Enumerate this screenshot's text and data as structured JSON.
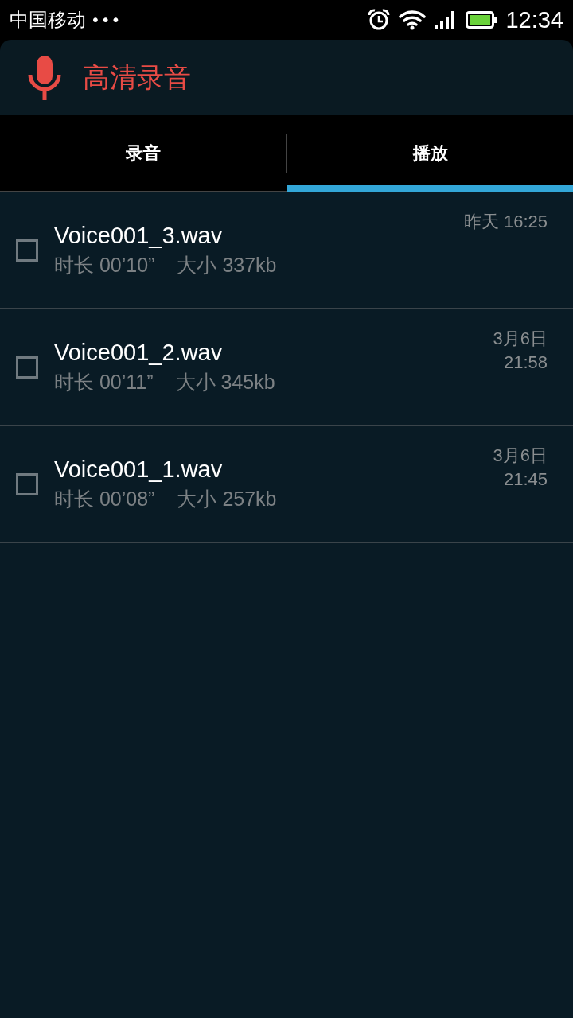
{
  "status_bar": {
    "carrier": "中国移动",
    "dots": "•••",
    "time": "12:34"
  },
  "header": {
    "title": "高清录音"
  },
  "tabs": [
    {
      "label": "录音",
      "selected": false
    },
    {
      "label": "播放",
      "selected": true
    }
  ],
  "recordings": [
    {
      "name": "Voice001_3.wav",
      "duration": "时长 00’10”",
      "size": "大小 337kb",
      "date_lines": [
        "昨天 16:25"
      ],
      "checked": false
    },
    {
      "name": "Voice001_2.wav",
      "duration": "时长 00’11”",
      "size": "大小 345kb",
      "date_lines": [
        "3月6日",
        "21:58"
      ],
      "checked": false
    },
    {
      "name": "Voice001_1.wav",
      "duration": "时长 00’08”",
      "size": "大小 257kb",
      "date_lines": [
        "3月6日",
        "21:45"
      ],
      "checked": false
    }
  ]
}
